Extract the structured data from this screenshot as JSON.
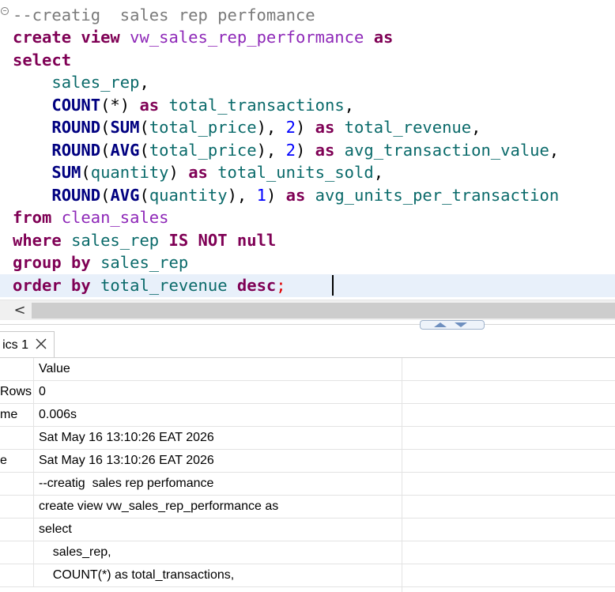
{
  "editor": {
    "comment": "--creatig  sales rep perfomance",
    "lines": {
      "l1_create": "create",
      "l1_view": "view",
      "l1_name": "vw_sales_rep_performance",
      "l1_as": "as",
      "l2_select": "select",
      "l3_col": "sales_rep",
      "l3_comma": ",",
      "l4_fn": "COUNT",
      "l4_args": "(*)",
      "l4_as": "as",
      "l4_alias": "total_transactions",
      "l4_comma": ",",
      "l5_fn1": "ROUND",
      "l5_p1": "(",
      "l5_fn2": "SUM",
      "l5_p2": "(",
      "l5_col": "total_price",
      "l5_p3": "), ",
      "l5_num": "2",
      "l5_p4": ")",
      "l5_as": "as",
      "l5_alias": "total_revenue",
      "l5_comma": ",",
      "l6_fn1": "ROUND",
      "l6_p1": "(",
      "l6_fn2": "AVG",
      "l6_p2": "(",
      "l6_col": "total_price",
      "l6_p3": "), ",
      "l6_num": "2",
      "l6_p4": ")",
      "l6_as": "as",
      "l6_alias": "avg_transaction_value",
      "l6_comma": ",",
      "l7_fn": "SUM",
      "l7_p1": "(",
      "l7_col": "quantity",
      "l7_p2": ")",
      "l7_as": "as",
      "l7_alias": "total_units_sold",
      "l7_comma": ",",
      "l8_fn1": "ROUND",
      "l8_p1": "(",
      "l8_fn2": "AVG",
      "l8_p2": "(",
      "l8_col": "quantity",
      "l8_p3": "), ",
      "l8_num": "1",
      "l8_p4": ")",
      "l8_as": "as",
      "l8_alias": "avg_units_per_transaction",
      "l9_from": "from",
      "l9_table": "clean_sales",
      "l10_where": "where",
      "l10_col": "sales_rep",
      "l10_isnotnull": "IS NOT null",
      "l11_groupby": "group by",
      "l11_col": "sales_rep",
      "l12_orderby": "order by",
      "l12_col": "total_revenue",
      "l12_desc": "desc",
      "l12_semi": ";"
    }
  },
  "scrollbar": {
    "left_arrow": "<"
  },
  "results_tab": {
    "label": "ics 1"
  },
  "results": {
    "header_value": "Value",
    "rows": [
      {
        "name": "Rows",
        "value": "0"
      },
      {
        "name": "me",
        "value": "0.006s"
      },
      {
        "name": "",
        "value": "Sat May 16 13:10:26 EAT 2026"
      },
      {
        "name": "e",
        "value": "Sat May 16 13:10:26 EAT 2026"
      },
      {
        "name": "",
        "value": "--creatig  sales rep perfomance"
      },
      {
        "name": "",
        "value": "create view vw_sales_rep_performance as"
      },
      {
        "name": "",
        "value": "select"
      },
      {
        "name": "",
        "value": "    sales_rep,"
      },
      {
        "name": "",
        "value": "    COUNT(*) as total_transactions,"
      }
    ]
  },
  "colors": {
    "keyword": "#7f0055",
    "function": "#000080",
    "identifier": "#0a6a6a",
    "view_name": "#8e28b8",
    "number": "#0000ff",
    "comment": "#7a7a7a",
    "current_line": "#e8f0fa"
  }
}
